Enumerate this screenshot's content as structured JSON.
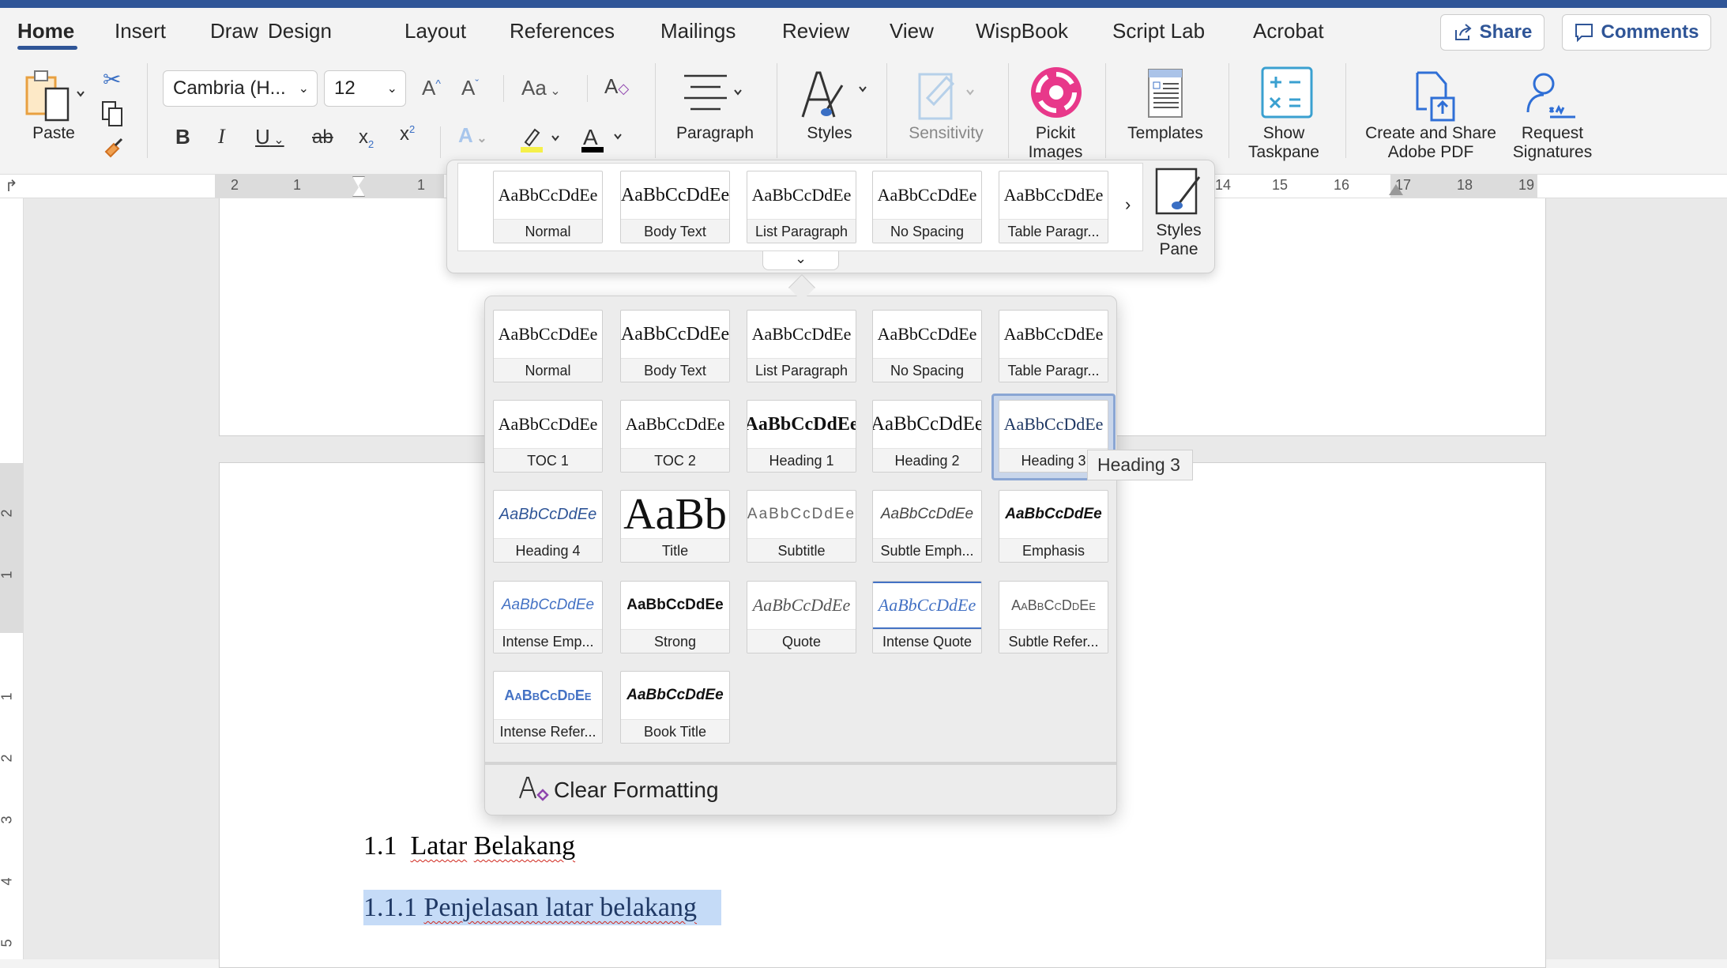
{
  "tabs": [
    "Home",
    "Insert",
    "Draw",
    "Design",
    "Layout",
    "References",
    "Mailings",
    "Review",
    "View",
    "WispBook",
    "Script Lab",
    "Acrobat"
  ],
  "active_tab": "Home",
  "share_label": "Share",
  "comments_label": "Comments",
  "ribbon": {
    "paste": "Paste",
    "font_name": "Cambria (H...",
    "font_size": "12",
    "change_case": "Aa",
    "paragraph": "Paragraph",
    "styles": "Styles",
    "sensitivity": "Sensitivity",
    "pickit": "Pickit Images",
    "templates": "Templates",
    "show_taskpane": "Show Taskpane",
    "create_pdf": "Create and Share Adobe PDF",
    "request_signatures": "Request Signatures",
    "highlight_color": "#f5f04a",
    "font_color": "#000000"
  },
  "ruler": {
    "left": [
      "2",
      "1",
      "1"
    ],
    "right": [
      "14",
      "15",
      "16",
      "17",
      "18",
      "19"
    ],
    "vertical": [
      "2",
      "1",
      "1",
      "2",
      "3",
      "4",
      "5"
    ]
  },
  "styles_strip": {
    "items": [
      {
        "preview": "AaBbCcDdEe",
        "name": "Normal"
      },
      {
        "preview": "AaBbCcDdEe",
        "name": "Body Text"
      },
      {
        "preview": "AaBbCcDdEe",
        "name": "List Paragraph"
      },
      {
        "preview": "AaBbCcDdEe",
        "name": "No Spacing"
      },
      {
        "preview": "AaBbCcDdEe",
        "name": "Table Paragr..."
      }
    ],
    "styles_pane": "Styles Pane"
  },
  "styles_gallery": {
    "items": [
      {
        "preview": "AaBbCcDdEe",
        "name": "Normal"
      },
      {
        "preview": "AaBbCcDdEe",
        "name": "Body Text"
      },
      {
        "preview": "AaBbCcDdEe",
        "name": "List Paragraph"
      },
      {
        "preview": "AaBbCcDdEe",
        "name": "No Spacing"
      },
      {
        "preview": "AaBbCcDdEe",
        "name": "Table Paragr..."
      },
      {
        "preview": "AaBbCcDdEe",
        "name": "TOC 1"
      },
      {
        "preview": "AaBbCcDdEe",
        "name": "TOC 2"
      },
      {
        "preview": "AaBbCcDdEe",
        "name": "Heading 1"
      },
      {
        "preview": "AaBbCcDdEe",
        "name": "Heading 2"
      },
      {
        "preview": "AaBbCcDdEe",
        "name": "Heading 3"
      },
      {
        "preview": "AaBbCcDdEe",
        "name": "Heading 4"
      },
      {
        "preview": "AaBb",
        "name": "Title"
      },
      {
        "preview": "AaBbCcDdEe",
        "name": "Subtitle"
      },
      {
        "preview": "AaBbCcDdEe",
        "name": "Subtle Emph..."
      },
      {
        "preview": "AaBbCcDdEe",
        "name": "Emphasis"
      },
      {
        "preview": "AaBbCcDdEe",
        "name": "Intense Emp..."
      },
      {
        "preview": "AaBbCcDdEe",
        "name": "Strong"
      },
      {
        "preview": "AaBbCcDdEe",
        "name": "Quote"
      },
      {
        "preview": "AaBbCcDdEe",
        "name": "Intense Quote"
      },
      {
        "preview": "AaBbCcDdEe",
        "name": "Subtle Refer..."
      },
      {
        "preview": "AaBbCcDdEe",
        "name": "Intense Refer..."
      },
      {
        "preview": "AaBbCcDdEe",
        "name": "Book Title"
      }
    ],
    "selected": "Heading 3",
    "tooltip": "Heading 3",
    "clear_formatting": "Clear Formatting"
  },
  "document": {
    "heading2_num": "1.1",
    "heading2_words": [
      "Latar",
      "Belakang"
    ],
    "heading3_num": "1.1.1",
    "heading3_text": "Penjelasan latar belakang",
    "selection_color": "#c5dbf7"
  }
}
